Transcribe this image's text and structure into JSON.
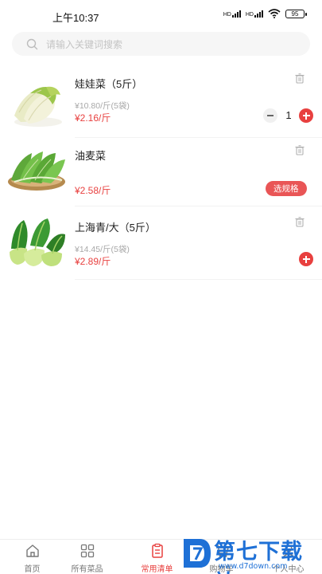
{
  "status_bar": {
    "time": "上午10:37",
    "signal_1": "HD",
    "signal_2": "HD",
    "battery": "95"
  },
  "search": {
    "placeholder": "请输入关键词搜索"
  },
  "products": [
    {
      "name": "娃娃菜（5斤）",
      "sub_price": "¥10.80/斤(5袋)",
      "price": "¥2.16/斤",
      "quantity": "1",
      "image_icon": "napa-cabbage-image"
    },
    {
      "name": "油麦菜",
      "price": "¥2.58/斤",
      "spec_button": "选规格",
      "image_icon": "lettuce-image"
    },
    {
      "name": "上海青/大（5斤）",
      "sub_price": "¥14.45/斤(5袋)",
      "price": "¥2.89/斤",
      "image_icon": "bok-choy-image"
    }
  ],
  "tab_bar": {
    "tabs": [
      {
        "label": "首页",
        "icon": "home-icon"
      },
      {
        "label": "所有菜品",
        "icon": "grid-icon"
      },
      {
        "label": "常用清单",
        "icon": "list-icon",
        "active": true
      },
      {
        "label": "购物车",
        "icon": "cart-icon"
      },
      {
        "label": "个人中心",
        "icon": "user-icon"
      }
    ]
  },
  "watermark": {
    "text": "第七下载站",
    "url": "www.d7down.com"
  },
  "colors": {
    "accent": "#e8403f",
    "watermark": "#1e70d6"
  }
}
